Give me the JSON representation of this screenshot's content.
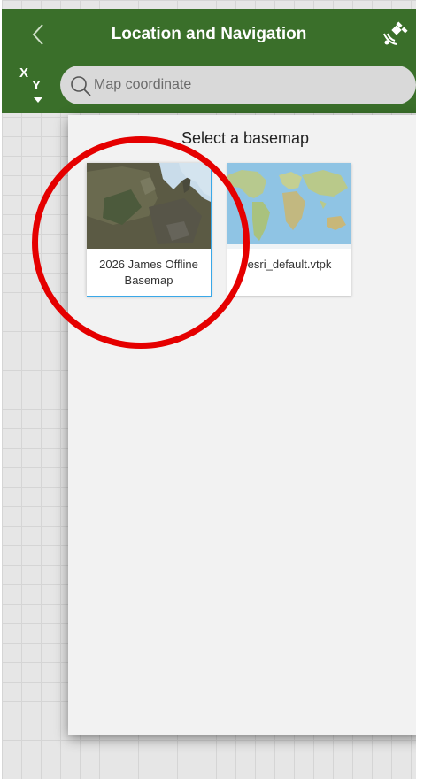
{
  "header": {
    "title": "Location and Navigation",
    "back_icon": "chevron-left-icon",
    "gps_icon": "satellite-icon"
  },
  "search": {
    "xy_x": "X",
    "xy_y": "Y",
    "placeholder": "Map coordinate"
  },
  "dialog": {
    "title": "Select a basemap",
    "basemaps": [
      {
        "label": "2026 James Offline Basemap",
        "selected": true
      },
      {
        "label": "esri_default.vtpk",
        "selected": false
      }
    ]
  },
  "map_tools": [
    "grid-icon",
    "zoom-in-icon",
    "home-icon",
    "zoom-out-icon",
    "locate-icon"
  ],
  "colors": {
    "header": "#3a6f2a",
    "highlight": "#e50000",
    "selection": "#3aa8e8"
  }
}
